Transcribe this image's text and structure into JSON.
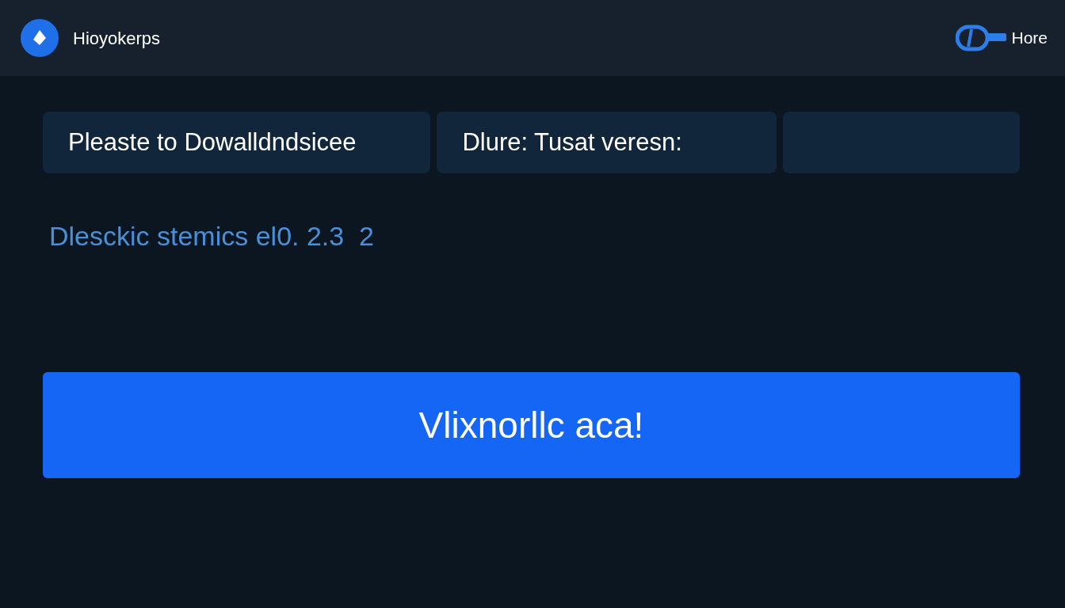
{
  "header": {
    "brand": "Hioyokerps",
    "nav_link": "Hore"
  },
  "info_panels": [
    {
      "kind": "text",
      "label": "Pleaste to Dowalldndsicee"
    },
    {
      "kind": "text",
      "label": "Dlure: Tusat veresn:"
    },
    {
      "kind": "empty"
    }
  ],
  "version_line": "Dlesckic stemics el0. 2.3  2",
  "primary_button": "Vlixnorllc aca!"
}
